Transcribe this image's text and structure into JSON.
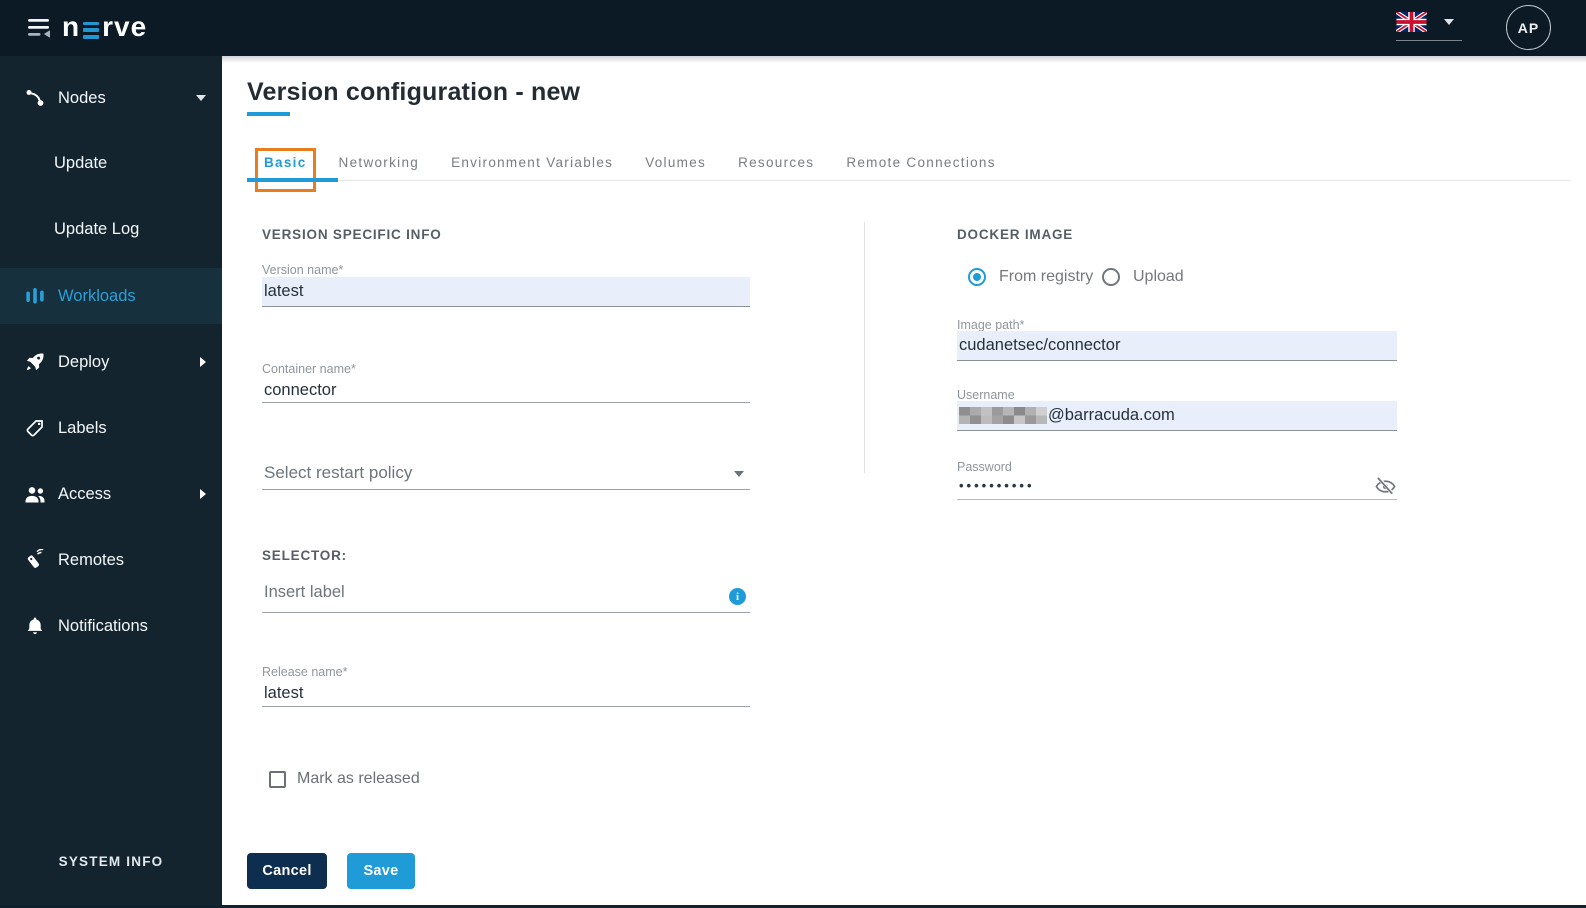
{
  "header": {
    "brand": {
      "left": "n",
      "right": "rve"
    },
    "avatar_initials": "AP"
  },
  "sidebar": {
    "items": [
      {
        "label": "Nodes",
        "icon": "nodes-icon",
        "expanded": true
      },
      {
        "label": "Update",
        "sub_item": true
      },
      {
        "label": "Update Log",
        "sub_item": true
      },
      {
        "label": "Workloads",
        "icon": "workloads-icon",
        "active": true
      },
      {
        "label": "Deploy",
        "icon": "rocket-icon",
        "collapsible": true
      },
      {
        "label": "Labels",
        "icon": "tag-icon"
      },
      {
        "label": "Access",
        "icon": "people-icon",
        "collapsible": true
      },
      {
        "label": "Remotes",
        "icon": "remote-icon"
      },
      {
        "label": "Notifications",
        "icon": "bell-icon"
      }
    ],
    "footer_label": "SYSTEM INFO"
  },
  "page": {
    "title": "Version configuration - new",
    "tabs": [
      {
        "label": "Basic",
        "active": true,
        "highlighted": true
      },
      {
        "label": "Networking"
      },
      {
        "label": "Environment Variables"
      },
      {
        "label": "Volumes"
      },
      {
        "label": "Resources"
      },
      {
        "label": "Remote Connections"
      }
    ]
  },
  "form": {
    "left": {
      "section_title": "VERSION SPECIFIC INFO",
      "version_name": {
        "label": "Version name*",
        "value": "latest"
      },
      "container_name": {
        "label": "Container name*",
        "value": "connector"
      },
      "restart_policy_placeholder": "Select restart policy",
      "selector_title": "SELECTOR:",
      "selector_placeholder": "Insert label",
      "release_name": {
        "label": "Release name*",
        "value": "latest"
      },
      "mark_released": {
        "label": "Mark as released",
        "checked": false
      }
    },
    "right": {
      "section_title": "DOCKER IMAGE",
      "source_options": [
        {
          "label": "From registry",
          "selected": true
        },
        {
          "label": "Upload",
          "selected": false
        }
      ],
      "image_path": {
        "label": "Image path*",
        "value": "cudanetsec/connector"
      },
      "username": {
        "label": "Username",
        "value_visible": "@barracuda.com",
        "redacted_prefix": true
      },
      "password": {
        "label": "Password",
        "masked_value": "••••••••••"
      }
    },
    "actions": {
      "cancel_label": "Cancel",
      "save_label": "Save"
    }
  },
  "colors": {
    "accent_blue": "#1f9bd7",
    "sidebar_active_blue": "#2a9fd8",
    "highlight_orange": "#e87d1e",
    "dark_button_navy": "#0e2e4f",
    "input_highlight_bg": "#e8effa",
    "topbar_bg": "#0c1a26",
    "sidebar_bg": "#13242f"
  }
}
